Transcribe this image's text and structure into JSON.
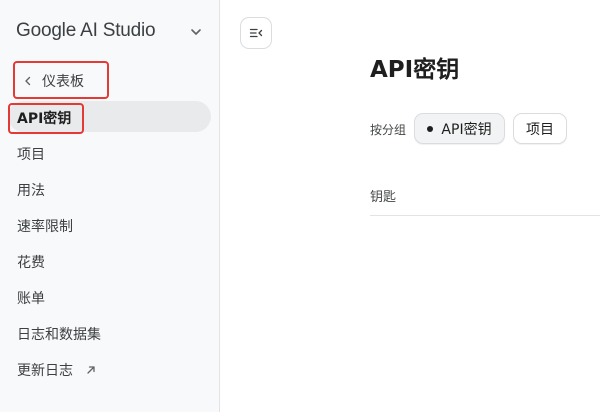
{
  "sidebar": {
    "brand": "Google AI Studio",
    "back_label": "仪表板",
    "items": [
      {
        "label": "API密钥"
      },
      {
        "label": "项目"
      },
      {
        "label": "用法"
      },
      {
        "label": "速率限制"
      },
      {
        "label": "花费"
      },
      {
        "label": "账单"
      },
      {
        "label": "日志和数据集"
      },
      {
        "label": "更新日志"
      }
    ]
  },
  "main": {
    "title": "API密钥",
    "group_by_label": "按分组",
    "chips": [
      {
        "label": "API密钥",
        "selected": true
      },
      {
        "label": "项目",
        "selected": false
      }
    ],
    "table": {
      "columns": [
        "钥匙"
      ]
    }
  },
  "colors": {
    "highlight_border": "#e53935",
    "sidebar_bg": "#f8f9fa",
    "active_item_bg": "#e9eaec"
  },
  "icons": [
    "chevron-down-icon",
    "chevron-left-icon",
    "external-link-icon",
    "sidebar-toggle-icon"
  ]
}
